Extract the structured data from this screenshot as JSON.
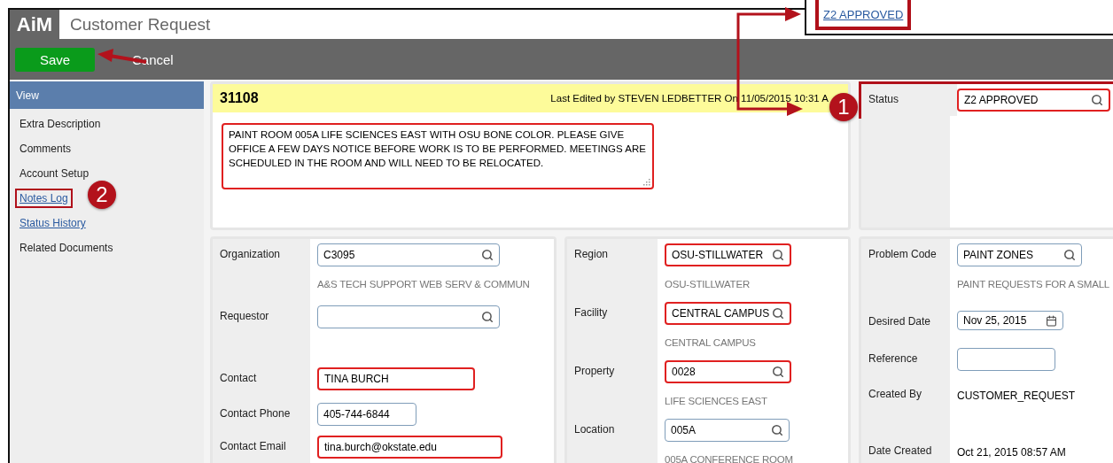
{
  "app": {
    "logo": "AiM",
    "title": "Customer Request"
  },
  "toolbar": [
    {
      "label": "Save",
      "kind": "primary"
    },
    {
      "label": "Cancel",
      "kind": "plain"
    }
  ],
  "callout": {
    "link": "Z2 APPROVED",
    "highlighted": true
  },
  "sidebar": {
    "header": "View",
    "items": [
      {
        "label": "Extra Description",
        "kind": "text",
        "highlighted": false
      },
      {
        "label": "Comments",
        "kind": "text",
        "highlighted": false
      },
      {
        "label": "Account Setup",
        "kind": "text",
        "highlighted": false
      },
      {
        "label": "Notes Log",
        "kind": "link",
        "highlighted": true
      },
      {
        "label": "Status History",
        "kind": "link",
        "highlighted": false
      },
      {
        "label": "Related Documents",
        "kind": "text",
        "highlighted": false
      }
    ]
  },
  "record": {
    "number": "31108",
    "last_edited": "Last Edited by STEVEN LEDBETTER On 11/05/2015 10:31 A",
    "description": "PAINT ROOM 005A LIFE SCIENCES EAST WITH OSU BONE COLOR.  PLEASE GIVE OFFICE A FEW DAYS NOTICE BEFORE WORK IS TO BE PERFORMED.  MEETINGS ARE SCHEDULED IN THE ROOM AND WILL NEED TO BE RELOCATED.",
    "highlighted": true
  },
  "status": {
    "label": "Status",
    "value": "Z2 APPROVED",
    "highlighted": true
  },
  "sections": [
    [
      {
        "label": "Organization",
        "kind": "lookup",
        "value": "C3095",
        "highlighted": false,
        "note": "A&S TECH SUPPORT WEB SERV & COMMUN"
      },
      {
        "label": "Requestor",
        "kind": "lookup",
        "highlighted": false
      },
      {
        "label": "Contact",
        "kind": "text",
        "value": "TINA BURCH",
        "highlighted": true
      },
      {
        "label": "Contact Phone",
        "kind": "text",
        "value": "405-744-6844",
        "highlighted": false
      },
      {
        "label": "Contact Email",
        "kind": "text",
        "value": "tina.burch@okstate.edu",
        "highlighted": true
      }
    ],
    [
      {
        "label": "Region",
        "kind": "lookup",
        "value": "OSU-STILLWATER",
        "highlighted": true,
        "note": "OSU-STILLWATER"
      },
      {
        "label": "Facility",
        "kind": "lookup",
        "value": "CENTRAL CAMPUS",
        "highlighted": true,
        "note": "CENTRAL CAMPUS"
      },
      {
        "label": "Property",
        "kind": "lookup",
        "value": "0028",
        "highlighted": true,
        "note": "LIFE SCIENCES EAST"
      },
      {
        "label": "Location",
        "kind": "lookup",
        "value": "005A",
        "highlighted": false,
        "note": "005A CONFERENCE ROOM"
      }
    ],
    [
      {
        "label": "Problem Code",
        "kind": "lookup",
        "value": "PAINT ZONES",
        "highlighted": false,
        "note": "PAINT REQUESTS FOR A SMALL"
      },
      {
        "label": "Desired Date",
        "kind": "date",
        "value": "Nov 25, 2015",
        "highlighted": false
      },
      {
        "label": "Reference",
        "kind": "text",
        "highlighted": false
      },
      {
        "label": "Created By",
        "kind": "plain",
        "value": "CUSTOMER_REQUEST"
      },
      {
        "label": "Date Created",
        "kind": "plain",
        "value": "Oct 21, 2015 08:57 AM"
      }
    ]
  ],
  "markers": [
    "1",
    "2"
  ]
}
